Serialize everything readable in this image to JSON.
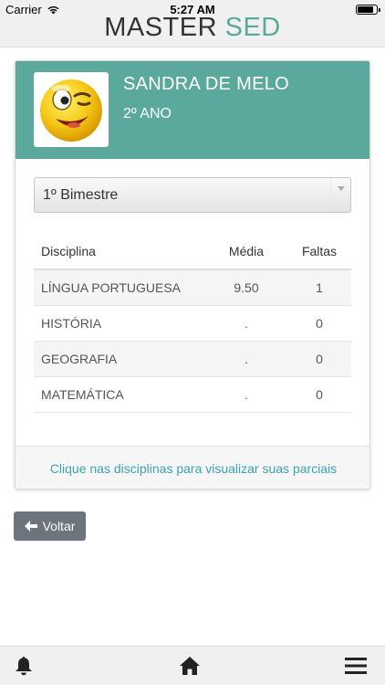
{
  "status": {
    "carrier": "Carrier",
    "time": "5:27 AM"
  },
  "header": {
    "title_part1": "MASTER",
    "title_part2": "SED"
  },
  "student": {
    "name": "SANDRA DE MELO",
    "grade": "2º ANO"
  },
  "period_select": {
    "value": "1º Bimestre"
  },
  "grades": {
    "columns": [
      "Disciplina",
      "Média",
      "Faltas"
    ],
    "rows": [
      {
        "disciplina": "LÍNGUA PORTUGUESA",
        "media": "9.50",
        "faltas": "1"
      },
      {
        "disciplina": "HISTÓRIA",
        "media": ".",
        "faltas": "0"
      },
      {
        "disciplina": "GEOGRAFIA",
        "media": ".",
        "faltas": "0"
      },
      {
        "disciplina": "MATEMÁTICA",
        "media": ".",
        "faltas": "0"
      }
    ]
  },
  "footer_hint": "Clique nas disciplinas para visualizar suas parciais",
  "back_button": {
    "label": "Voltar"
  },
  "bottom_nav": {
    "items": [
      "bell-icon",
      "home-icon",
      "menu-icon"
    ]
  },
  "colors": {
    "accent": "#5aa99c",
    "link": "#3ba3b2",
    "button": "#6c757d"
  }
}
